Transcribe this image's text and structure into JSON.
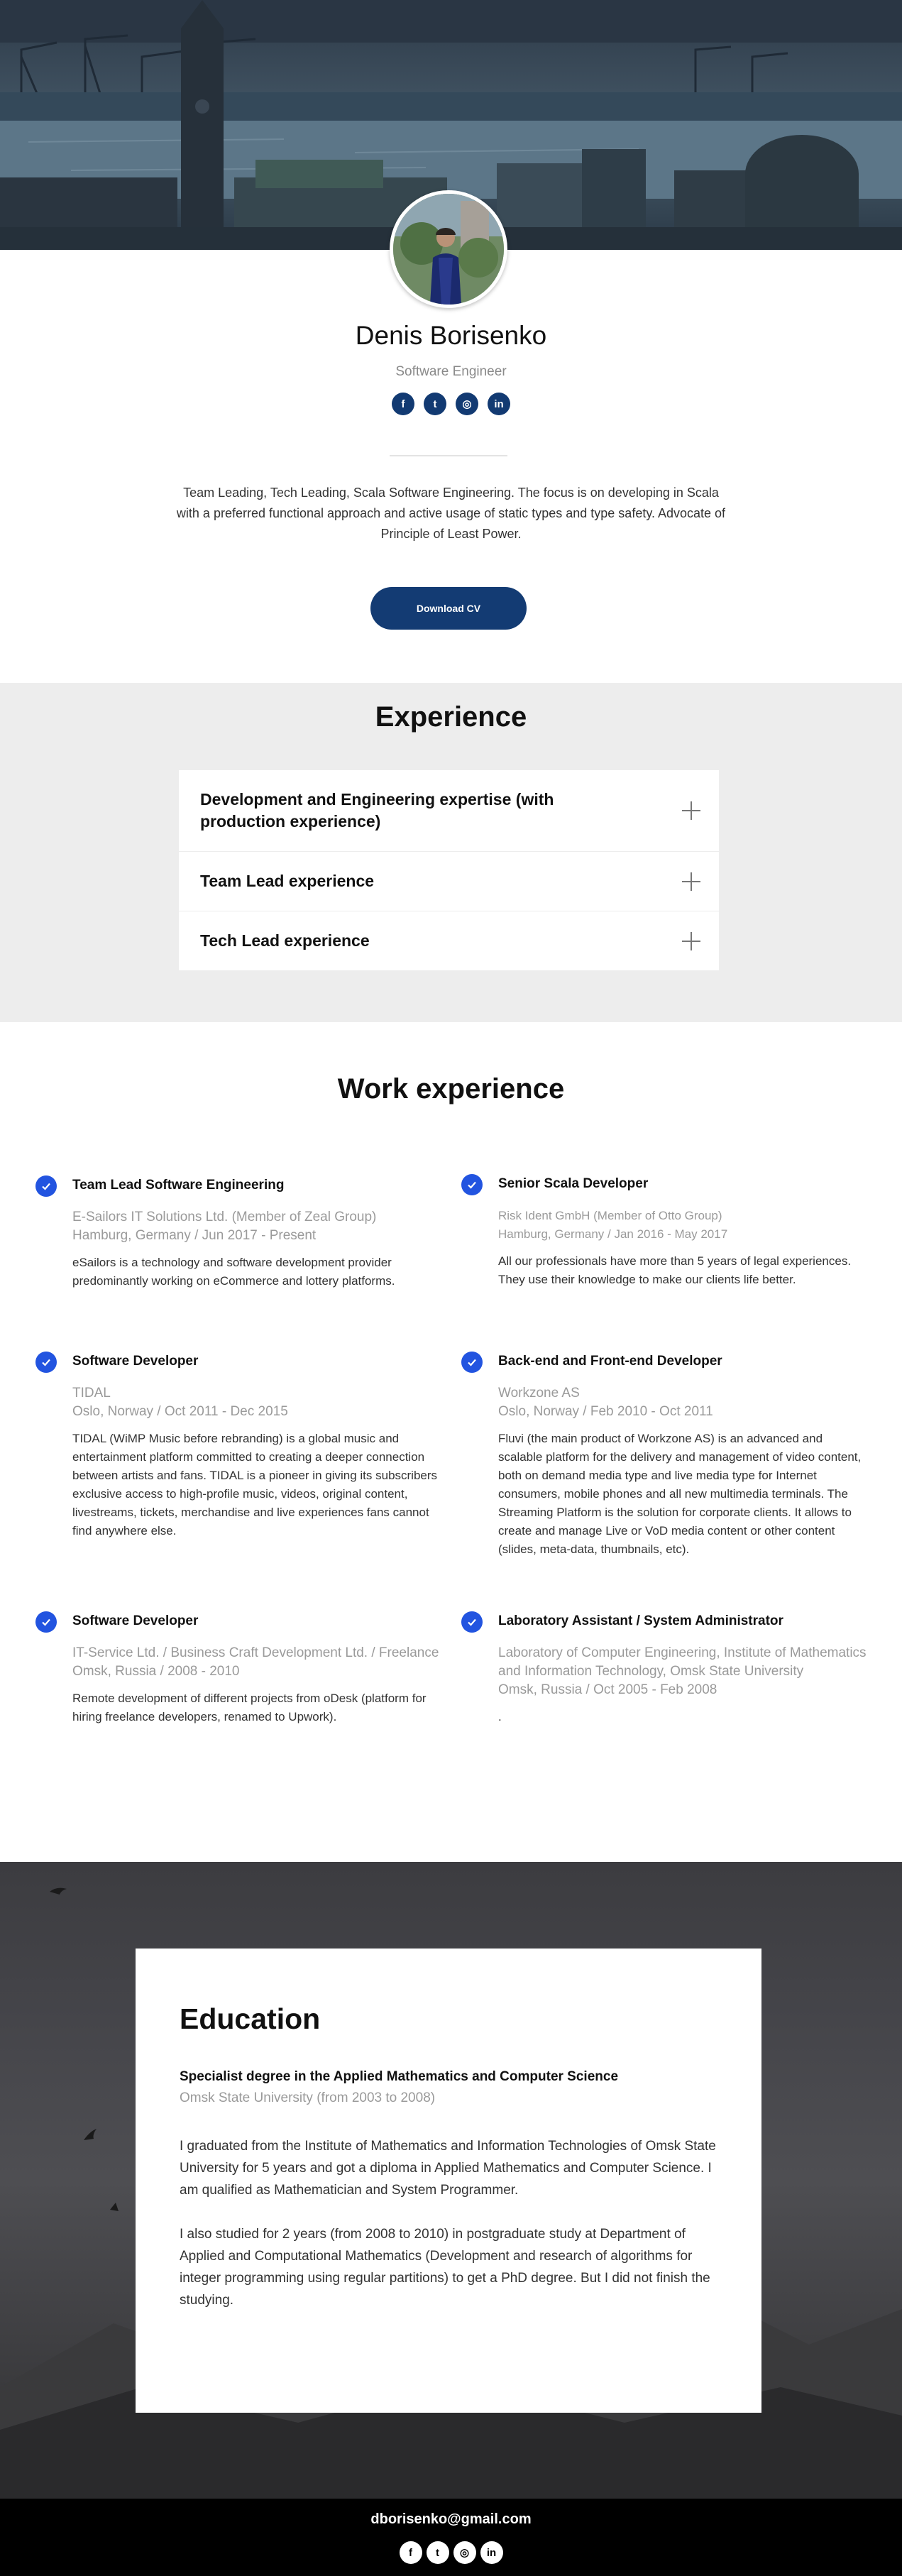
{
  "header": {
    "name": "Denis Borisenko",
    "role": "Software Engineer",
    "socials": [
      {
        "icon": "facebook-icon",
        "glyph": "f"
      },
      {
        "icon": "twitter-icon",
        "glyph": "t"
      },
      {
        "icon": "instagram-icon",
        "glyph": "◎"
      },
      {
        "icon": "linkedin-icon",
        "glyph": "in"
      }
    ],
    "bio": "Team Leading, Tech Leading, Scala Software Engineering. The focus is on developing in Scala with a preferred functional approach and active usage of static types and type safety. Advocate of Principle of Least Power.",
    "cv_button": "Download CV"
  },
  "experience": {
    "title": "Experience",
    "items": [
      {
        "label": "Development and Engineering expertise (with production experience)"
      },
      {
        "label": "Team Lead experience"
      },
      {
        "label": "Tech Lead experience"
      }
    ]
  },
  "work": {
    "title": "Work experience",
    "jobs": [
      {
        "title": "Team Lead Software Engineering",
        "company": "E-Sailors IT Solutions Ltd. (Member of Zeal Group)",
        "meta": "Hamburg, Germany / Jun 2017 - Present",
        "desc": "eSailors is a technology and software development provider predominantly working on eCommerce and lottery platforms."
      },
      {
        "title": "Senior Scala Developer",
        "company": "Risk Ident GmbH (Member of Otto Group)",
        "meta": "Hamburg, Germany / Jan 2016 - May 2017",
        "desc": "All our professionals have more than 5 years of legal experiences. They use their knowledge to make our clients life better."
      },
      {
        "title": "Software Developer",
        "company": "TIDAL",
        "meta": "Oslo, Norway / Oct 2011 - Dec 2015",
        "desc": "TIDAL (WiMP Music before rebranding) is a global music and entertainment platform committed to creating a deeper connection between artists and fans. TIDAL is a pioneer in giving its subscribers exclusive access to high-profile music, videos, original content, livestreams, tickets, merchandise and live experiences fans cannot find anywhere else."
      },
      {
        "title": "Back-end and Front-end Developer",
        "company": "Workzone AS",
        "meta": "Oslo, Norway / Feb 2010 - Oct 2011",
        "desc": "Fluvi (the main product of Workzone AS) is an advanced and scalable platform for the delivery and management of video content, both on demand media type and live media type for Internet consumers, mobile phones and all new multimedia terminals. The Streaming Platform is the solution for corporate clients. It allows to create and manage Live or VoD media content or other content (slides, meta-data, thumbnails, etc)."
      },
      {
        "title": "Software Developer",
        "company": "IT-Service Ltd. / Business Craft Development Ltd. / Freelance",
        "meta": "Omsk, Russia / 2008 - 2010",
        "desc": "Remote development of different projects from oDesk (platform for hiring freelance developers, renamed to Upwork)."
      },
      {
        "title": "Laboratory Assistant / System Administrator",
        "company": "Laboratory of Computer Engineering, Institute of Mathematics and Information Technology, Omsk State University",
        "meta": "Omsk, Russia / Oct 2005 - Feb 2008",
        "desc": "."
      }
    ]
  },
  "education": {
    "title": "Education",
    "degree": "Specialist degree in the Applied Mathematics and Computer Science",
    "school": "Omsk State University (from 2003 to 2008)",
    "p1": "I graduated from the Institute of Mathematics and Information Technologies of Omsk State University for 5 years and got a diploma in Applied Mathematics and Computer Science. I am qualified as Mathematician and System Programmer.",
    "p2": "I also studied for 2 years (from 2008 to 2010) in postgraduate study at Department of Applied and Computational Mathematics (Development and research of algorithms for integer programming using regular partitions) to get a PhD degree. But I did not finish the studying."
  },
  "footer": {
    "email": "dborisenko@gmail.com"
  },
  "colors": {
    "accent": "#133b73",
    "check": "#2254e0",
    "section_bg": "#ededed"
  }
}
